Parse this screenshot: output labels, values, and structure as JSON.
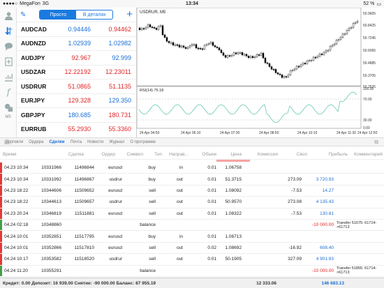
{
  "status": {
    "carrier": "MegaFon",
    "network": "3G",
    "time": "13:34",
    "battery": "52 %"
  },
  "quotes": {
    "tab_simple": "Просто",
    "tab_detail": "В деталях",
    "rows": [
      {
        "symbol": "AUDCAD",
        "bid": "0.94446",
        "ask": "0.94462",
        "bid_color": "blue",
        "ask_color": "red"
      },
      {
        "symbol": "AUDNZD",
        "bid": "1.02939",
        "ask": "1.02982",
        "bid_color": "blue",
        "ask_color": "blue"
      },
      {
        "symbol": "AUDJPY",
        "bid": "92.967",
        "ask": "92.999",
        "bid_color": "red",
        "ask_color": "blue"
      },
      {
        "symbol": "USDZAR",
        "bid": "12.22192",
        "ask": "12.23011",
        "bid_color": "red",
        "ask_color": "red"
      },
      {
        "symbol": "USDRUR",
        "bid": "51.0865",
        "ask": "51.1135",
        "bid_color": "red",
        "ask_color": "red"
      },
      {
        "symbol": "EURJPY",
        "bid": "129.328",
        "ask": "129.350",
        "bid_color": "red",
        "ask_color": "blue"
      },
      {
        "symbol": "GBPJPY",
        "bid": "180.685",
        "ask": "180.731",
        "bid_color": "blue",
        "ask_color": "red"
      },
      {
        "symbol": "EURRUB",
        "bid": "55.2930",
        "ask": "55.3360",
        "bid_color": "red",
        "ask_color": "red"
      }
    ]
  },
  "sidebar": {
    "m5_label": "M5"
  },
  "chart": {
    "title": "USDRUR, M5",
    "rsi_label": "RSI(14) 75.18",
    "price_ticks": [
      "50.9605",
      "50.8425",
      "50.7245",
      "50.6065",
      "50.4885",
      "50.3705",
      "50.2525"
    ],
    "rsi_ticks": [
      "100.00",
      "70.00",
      "30.00",
      "0.00"
    ],
    "time_ticks": [
      "24 Apr 04:50",
      "24 Apr 06:10",
      "24 Apr 07:30",
      "24 Apr 08:50",
      "24 Apr 10:10",
      "24 Apr 11:30",
      "24 Apr 12:50"
    ],
    "candle_color": "#000000",
    "rsi_color": "#55c0a8"
  },
  "tabs": [
    "Торговля",
    "Ордера",
    "Сделки",
    "Почта",
    "Новости",
    "Журнал",
    "О программе"
  ],
  "active_tab": "Сделки",
  "columns": [
    "Время",
    "Сделка",
    "Ордер",
    "Символ",
    "Тип",
    "Направ...",
    "Объем",
    "Цена",
    "Комиссия",
    "Своп",
    "Прибыль",
    "Комментарий"
  ],
  "deals": [
    {
      "time": "04.23 10:34",
      "deal": "10331966",
      "order": "11496844",
      "symbol": "eurusd",
      "type": "buy",
      "dir": "in",
      "volume": "0.01",
      "price": "1.06758",
      "commission": "",
      "swap": "",
      "profit": "",
      "profit_color": "#222",
      "comment": "",
      "bar": "#e53935"
    },
    {
      "time": "04.23 10:34",
      "deal": "10331992",
      "order": "11496867",
      "symbol": "usdrur",
      "type": "buy",
      "dir": "out",
      "volume": "0.01",
      "price": "51.3715",
      "commission": "",
      "swap": "273.09",
      "profit": "3 720.93",
      "profit_color": "#1a6fd6",
      "comment": "",
      "bar": "#e53935"
    },
    {
      "time": "04.23 18:22",
      "deal": "10344606",
      "order": "11509652",
      "symbol": "eurusd",
      "type": "sell",
      "dir": "out",
      "volume": "0.01",
      "price": "1.08092",
      "commission": "",
      "swap": "-7.53",
      "profit": "14.27",
      "profit_color": "#1a6fd6",
      "comment": "",
      "bar": "#e53935"
    },
    {
      "time": "04.23 18:22",
      "deal": "10344613",
      "order": "11509657",
      "symbol": "usdrur",
      "type": "sell",
      "dir": "out",
      "volume": "0.01",
      "price": "50.9570",
      "commission": "",
      "swap": "273.08",
      "profit": "4 135.43",
      "profit_color": "#1a6fd6",
      "comment": "",
      "bar": "#e53935"
    },
    {
      "time": "04.23 20:24",
      "deal": "10346819",
      "order": "11511881",
      "symbol": "eurusd",
      "type": "sell",
      "dir": "out",
      "volume": "0.01",
      "price": "1.08322",
      "commission": "",
      "swap": "-7.53",
      "profit": "130.81",
      "profit_color": "#1a6fd6",
      "comment": "",
      "bar": "#e53935"
    },
    {
      "time": "04.24 02:18",
      "deal": "10348860",
      "order": "",
      "symbol": "",
      "type": "balance",
      "dir": "",
      "volume": "",
      "price": "",
      "commission": "",
      "swap": "",
      "profit": "-10 000.00",
      "profit_color": "#e02424",
      "comment": "Transfer 51675: 61714->61713",
      "bar": "#43a047"
    },
    {
      "time": "04.24 10:01",
      "deal": "10352851",
      "order": "11517795",
      "symbol": "eurusd",
      "type": "buy",
      "dir": "in",
      "volume": "0.01",
      "price": "1.08713",
      "commission": "",
      "swap": "",
      "profit": "",
      "profit_color": "#222",
      "comment": "",
      "bar": "#e53935"
    },
    {
      "time": "04.24 10:01",
      "deal": "10352866",
      "order": "11517810",
      "symbol": "eurusd",
      "type": "sell",
      "dir": "out",
      "volume": "0.02",
      "price": "1.08692",
      "commission": "",
      "swap": "-16.92",
      "profit": "608.40",
      "profit_color": "#1a6fd6",
      "comment": "",
      "bar": "#e53935"
    },
    {
      "time": "04.24 10:17",
      "deal": "10353582",
      "order": "11518520",
      "symbol": "usdrur",
      "type": "sell",
      "dir": "out",
      "volume": "0.01",
      "price": "50.1905",
      "commission": "",
      "swap": "327.09",
      "profit": "4 901.93",
      "profit_color": "#1a6fd6",
      "comment": "",
      "bar": "#e53935"
    },
    {
      "time": "04.24 11:20",
      "deal": "10355291",
      "order": "",
      "symbol": "",
      "type": "balance",
      "dir": "",
      "volume": "",
      "price": "",
      "commission": "",
      "swap": "",
      "profit": "-10 000.00",
      "profit_color": "#e02424",
      "comment": "Transfer 51855: 61714->61713",
      "bar": "#43a047"
    }
  ],
  "footer": {
    "summary": "Кредит: 0.00 Депозит: 16 939.00 Снятие: -90 000.00 Баланс: 87 955.19",
    "swap_total": "12 333.06",
    "profit_total": "146 683.13"
  }
}
